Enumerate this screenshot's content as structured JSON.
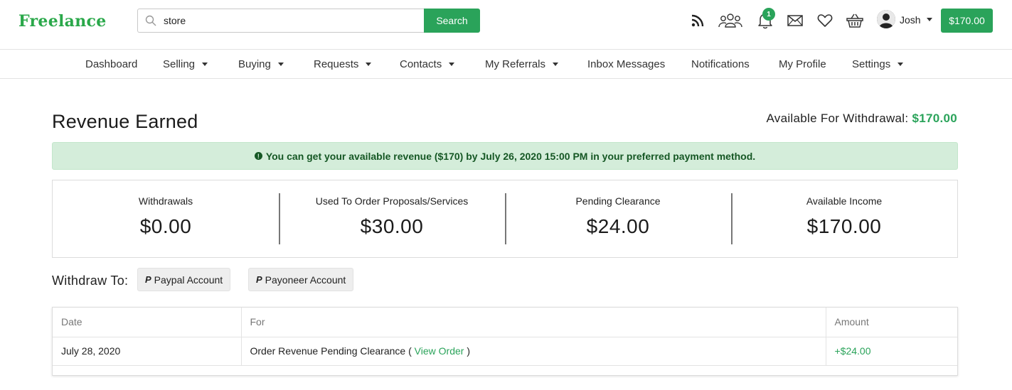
{
  "header": {
    "logo": "Freelance",
    "search": {
      "value": "store",
      "button_label": "Search"
    },
    "notification_count": "1",
    "user_name": "Josh",
    "balance": "$170.00"
  },
  "nav": {
    "items": [
      {
        "label": "Dashboard",
        "has_dropdown": false
      },
      {
        "label": "Selling",
        "has_dropdown": true
      },
      {
        "label": "Buying",
        "has_dropdown": true
      },
      {
        "label": "Requests",
        "has_dropdown": true
      },
      {
        "label": "Contacts",
        "has_dropdown": true
      },
      {
        "label": "My Referrals",
        "has_dropdown": true
      },
      {
        "label": "Inbox Messages",
        "has_dropdown": false
      },
      {
        "label": "Notifications",
        "has_dropdown": false
      },
      {
        "label": "My Profile",
        "has_dropdown": false
      },
      {
        "label": "Settings",
        "has_dropdown": true
      }
    ]
  },
  "page": {
    "title": "Revenue Earned",
    "withdrawal_label": "Available For Withdrawal:",
    "withdrawal_amount": "$170.00",
    "alert_text": "You can get your available revenue ($170) by July 26, 2020 15:00 PM in your preferred payment method."
  },
  "stats": [
    {
      "label": "Withdrawals",
      "value": "$0.00"
    },
    {
      "label": "Used To Order Proposals/Services",
      "value": "$30.00"
    },
    {
      "label": "Pending Clearance",
      "value": "$24.00"
    },
    {
      "label": "Available Income",
      "value": "$170.00"
    }
  ],
  "withdraw": {
    "label": "Withdraw To:",
    "paypal_label": "Paypal Account",
    "payoneer_label": "Payoneer Account"
  },
  "table": {
    "columns": [
      "Date",
      "For",
      "Amount"
    ],
    "rows": [
      {
        "date": "July 28, 2020",
        "for_text": "Order Revenue Pending Clearance",
        "link_open": "(",
        "link_text": "View Order",
        "link_close": ")",
        "amount": "+$24.00"
      }
    ]
  },
  "colors": {
    "accent": "#2aa35a",
    "alert_bg": "#d4edda",
    "alert_text": "#155724"
  }
}
